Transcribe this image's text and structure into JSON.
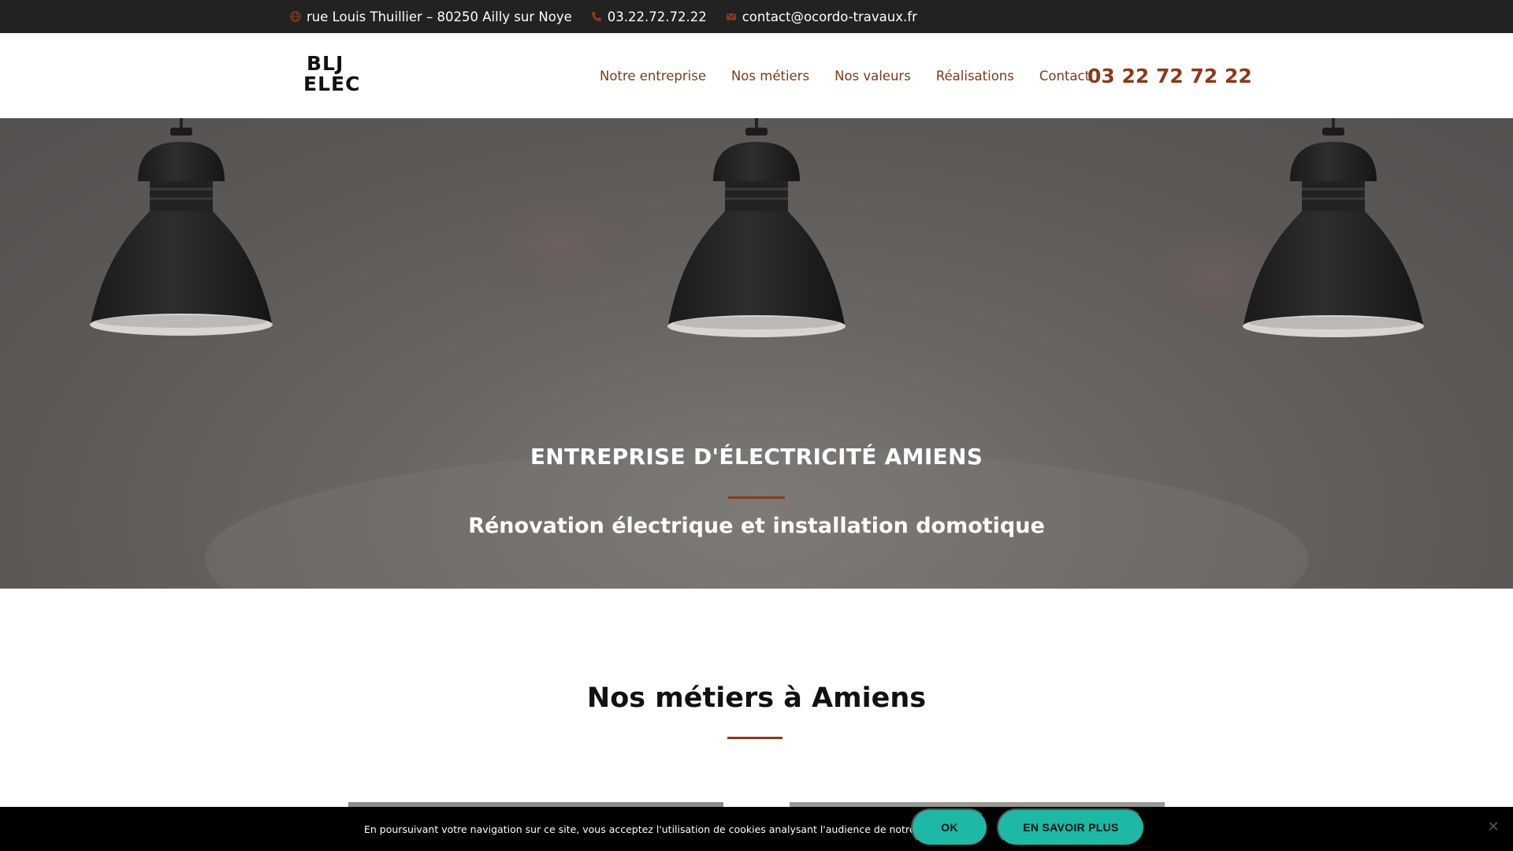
{
  "topbar": {
    "address": "rue Louis Thuillier – 80250 Ailly sur Noye",
    "phone": "03.22.72.72.22",
    "email": "contact@ocordo-travaux.fr",
    "address_icon": "globe-icon",
    "phone_icon": "phone-icon",
    "email_icon": "envelope-icon"
  },
  "header": {
    "logo_line1": "BLJ",
    "logo_line2": "ELEC",
    "nav": [
      {
        "label": "Notre entreprise"
      },
      {
        "label": "Nos métiers"
      },
      {
        "label": "Nos valeurs"
      },
      {
        "label": "Réalisations"
      },
      {
        "label": "Contact"
      }
    ],
    "phone": "03 22 72 72 22"
  },
  "hero": {
    "title": "ENTREPRISE D'ÉLECTRICITÉ AMIENS",
    "subtitle": "Rénovation électrique et installation domotique"
  },
  "section": {
    "title": "Nos métiers à Amiens"
  },
  "cookie": {
    "text": "En poursuivant votre navigation sur ce site, vous acceptez l'utilisation de cookies analysant l'audience de notre site web.",
    "ok_label": "OK",
    "more_label": "EN SAVOIR PLUS",
    "close_icon": "close-icon"
  },
  "colors": {
    "accent": "#8a3a1b",
    "topbar_bg": "#222222",
    "cookie_button": "#1eb8a6"
  }
}
